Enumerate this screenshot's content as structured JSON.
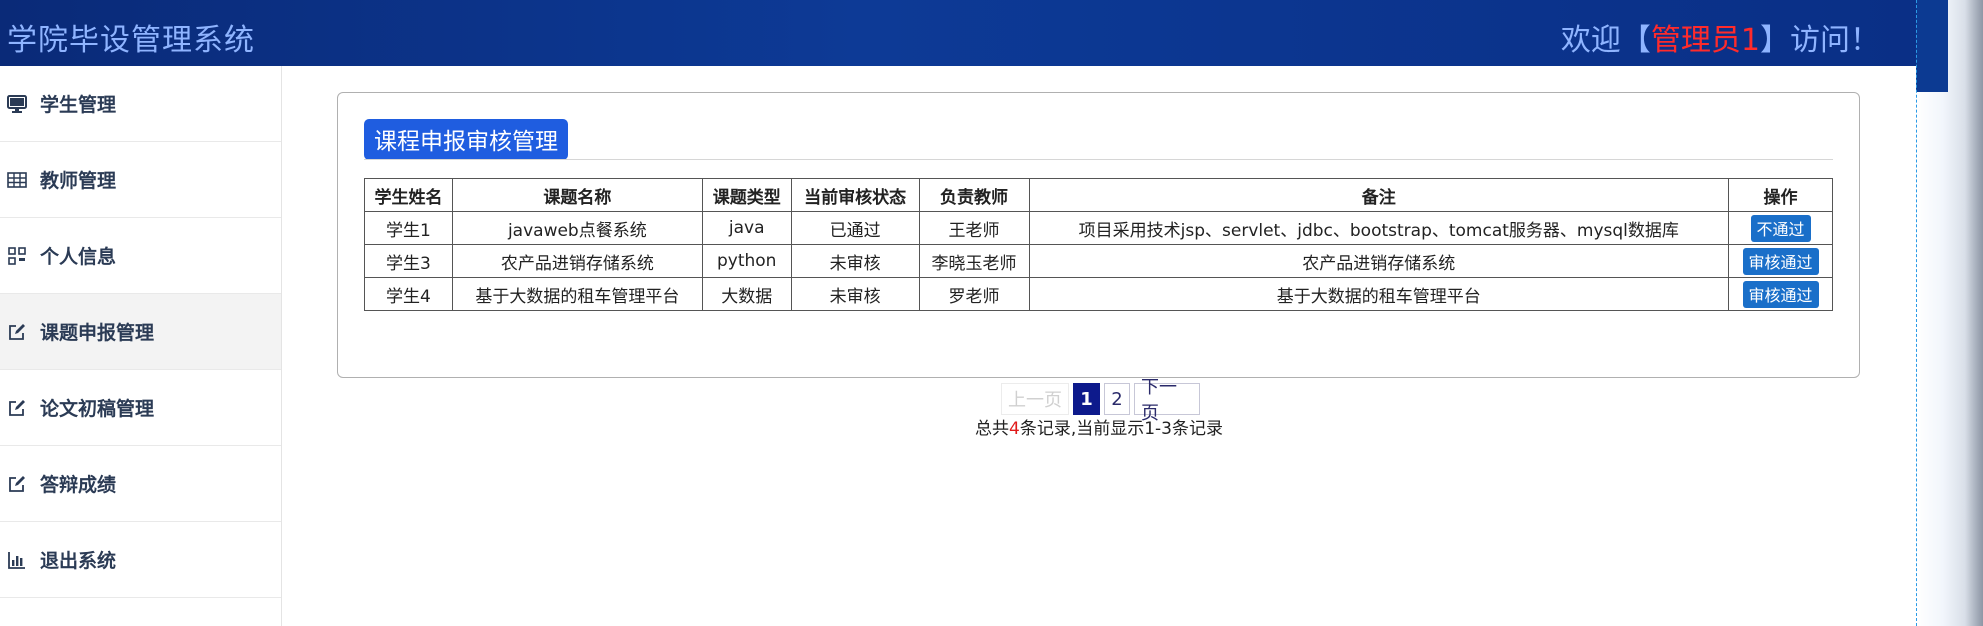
{
  "header": {
    "title": "学院毕设管理系统",
    "welcome_prefix": "欢迎【",
    "admin_name": "管理员1",
    "welcome_suffix": "】访问！"
  },
  "sidebar": {
    "items": [
      {
        "label": "学生管理",
        "icon": "monitor-icon",
        "active": false
      },
      {
        "label": "教师管理",
        "icon": "table-icon",
        "active": false
      },
      {
        "label": "个人信息",
        "icon": "grid-icon",
        "active": false
      },
      {
        "label": "课题申报管理",
        "icon": "edit-icon",
        "active": true
      },
      {
        "label": "论文初稿管理",
        "icon": "edit-icon",
        "active": false
      },
      {
        "label": "答辩成绩",
        "icon": "edit-icon",
        "active": false
      },
      {
        "label": "退出系统",
        "icon": "bar-chart-icon",
        "active": false
      }
    ]
  },
  "panel": {
    "title": "课程申报审核管理",
    "columns": [
      "学生姓名",
      "课题名称",
      "课题类型",
      "当前审核状态",
      "负责教师",
      "备注",
      "操作"
    ],
    "rows": [
      {
        "student": "学生1",
        "topic": "javaweb点餐系统",
        "type": "java",
        "status": "已通过",
        "teacher": "王老师",
        "note": "项目采用技术jsp、servlet、jdbc、bootstrap、tomcat服务器、mysql数据库",
        "action": "不通过"
      },
      {
        "student": "学生3",
        "topic": "农产品进销存储系统",
        "type": "python",
        "status": "未审核",
        "teacher": "李晓玉老师",
        "note": "农产品进销存储系统",
        "action": "审核通过"
      },
      {
        "student": "学生4",
        "topic": "基于大数据的租车管理平台",
        "type": "大数据",
        "status": "未审核",
        "teacher": "罗老师",
        "note": "基于大数据的租车管理平台",
        "action": "审核通过"
      }
    ]
  },
  "pagination": {
    "prev": "上一页",
    "pages": [
      "1",
      "2"
    ],
    "current": "1",
    "next": "下一页",
    "summary_prefix": "总共",
    "total": "4",
    "summary_suffix": "条记录,当前显示1-3条记录"
  },
  "colors": {
    "header_bg": "#0d3a96",
    "title_text": "#8fb4ff",
    "admin_text": "#ff2b2b",
    "panel_title_bg": "#1f5de0",
    "action_button": "#1a6fc9",
    "pager_current": "#0d1a8c",
    "total_count": "#e01b1b"
  }
}
